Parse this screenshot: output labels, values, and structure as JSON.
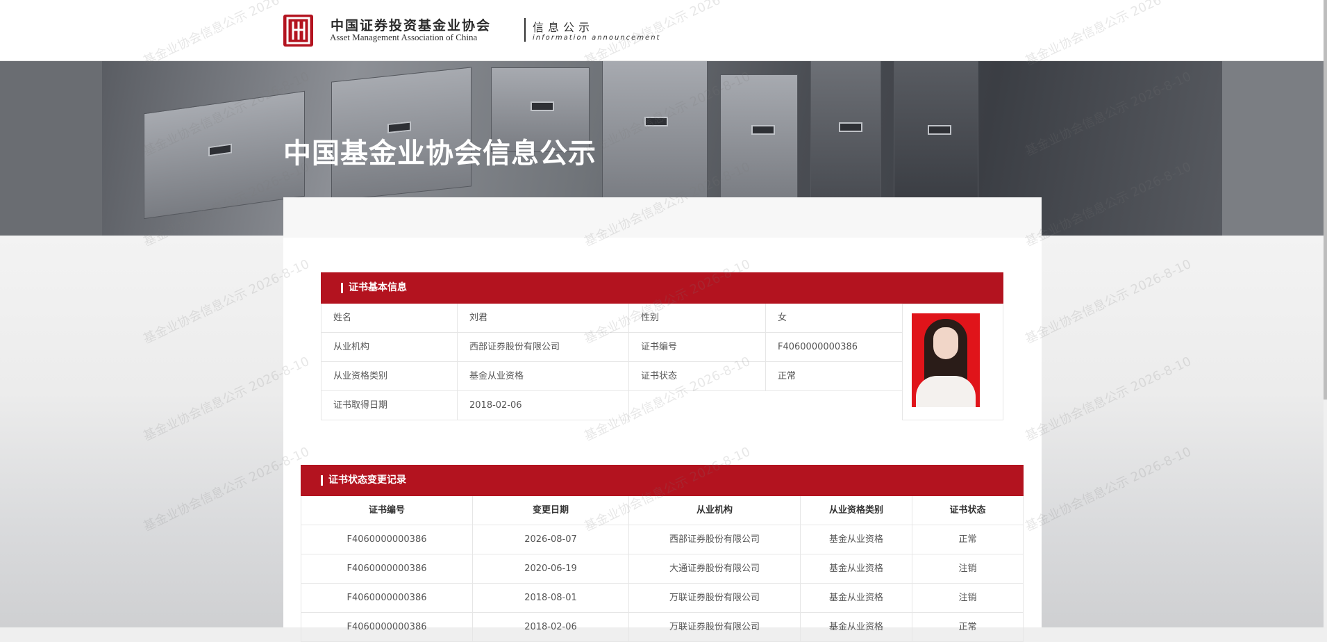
{
  "header": {
    "org_name_cn": "中国证券投资基金业协会",
    "org_name_en": "Asset Management Association of China",
    "sub_cn": "信息公示",
    "sub_en": "information announcement"
  },
  "hero": {
    "title": "中国基金业协会信息公示"
  },
  "certificate": {
    "section_title": "证书基本信息",
    "fields": [
      {
        "label": "姓名",
        "value": "刘君"
      },
      {
        "label": "性别",
        "value": "女"
      },
      {
        "label": "从业机构",
        "value": "西部证券股份有限公司"
      },
      {
        "label": "证书编号",
        "value": "F4060000000386"
      },
      {
        "label": "从业资格类别",
        "value": "基金从业资格"
      },
      {
        "label": "证书状态",
        "value": "正常"
      },
      {
        "label": "证书取得日期",
        "value": "2018-02-06"
      }
    ]
  },
  "history": {
    "section_title": "证书状态变更记录",
    "columns": [
      "证书编号",
      "变更日期",
      "从业机构",
      "从业资格类别",
      "证书状态"
    ],
    "rows": [
      [
        "F4060000000386",
        "2026-08-07",
        "西部证券股份有限公司",
        "基金从业资格",
        "正常"
      ],
      [
        "F4060000000386",
        "2020-06-19",
        "大通证券股份有限公司",
        "基金从业资格",
        "注销"
      ],
      [
        "F4060000000386",
        "2018-08-01",
        "万联证券股份有限公司",
        "基金从业资格",
        "注销"
      ],
      [
        "F4060000000386",
        "2018-02-06",
        "万联证券股份有限公司",
        "基金从业资格",
        "正常"
      ]
    ]
  },
  "watermark": {
    "text": "基金业协会信息公示 2026-8-10"
  },
  "colors": {
    "accent": "#b3131f"
  }
}
